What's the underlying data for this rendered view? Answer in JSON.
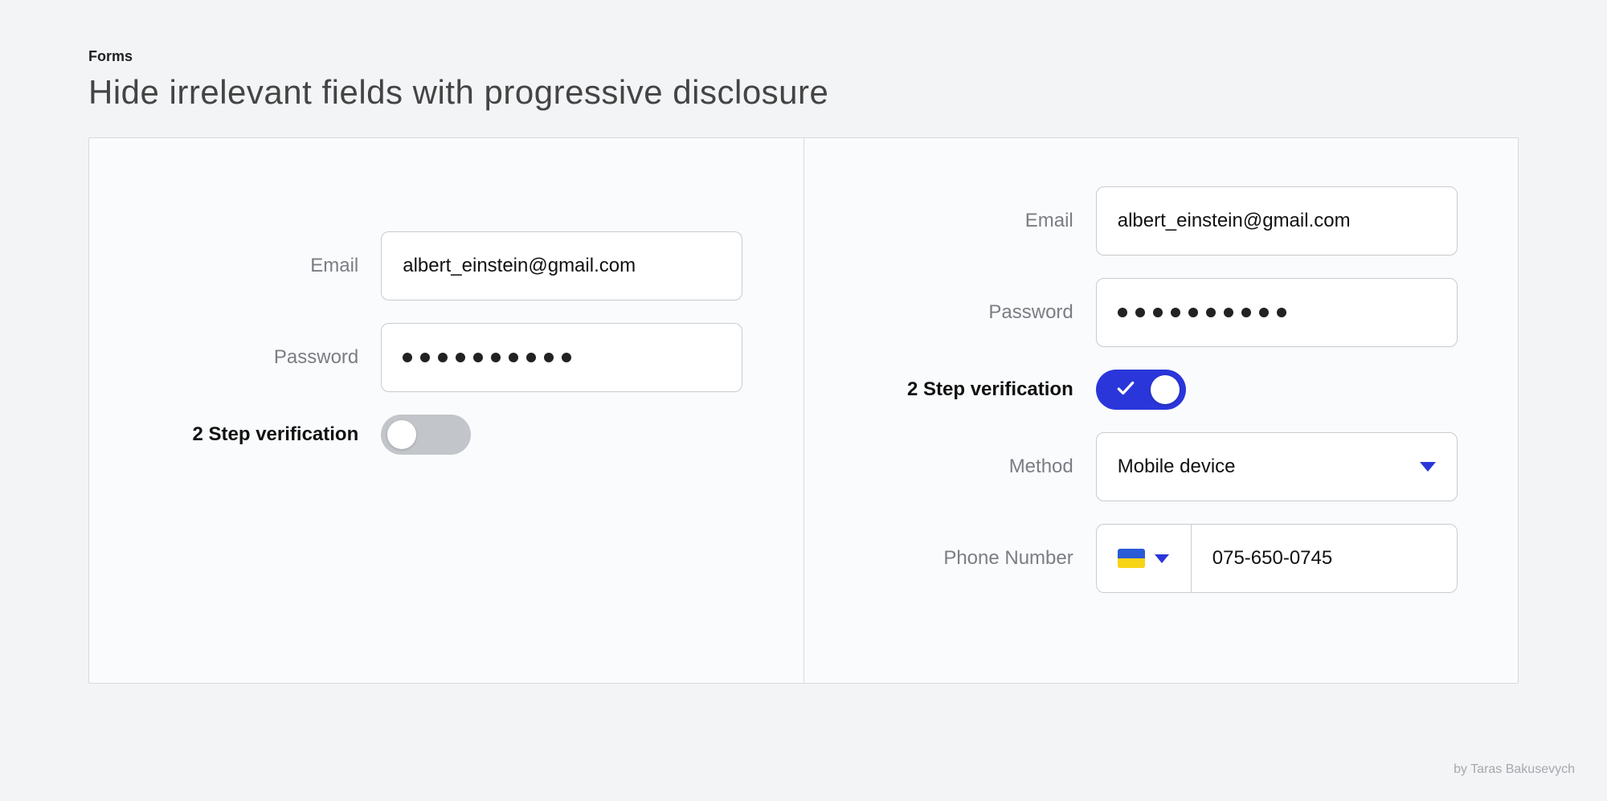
{
  "header": {
    "eyebrow": "Forms",
    "headline": "Hide irrelevant fields with progressive disclosure"
  },
  "left": {
    "email_label": "Email",
    "email_value": "albert_einstein@gmail.com",
    "password_label": "Password",
    "password_dots": 10,
    "twofa_label": "2 Step verification",
    "twofa_on": false
  },
  "right": {
    "email_label": "Email",
    "email_value": "albert_einstein@gmail.com",
    "password_label": "Password",
    "password_dots": 10,
    "twofa_label": "2 Step verification",
    "twofa_on": true,
    "method_label": "Method",
    "method_value": "Mobile device",
    "phone_label": "Phone Number",
    "phone_country": "UA",
    "phone_value": "075-650-0745"
  },
  "credit": "by Taras Bakusevych"
}
